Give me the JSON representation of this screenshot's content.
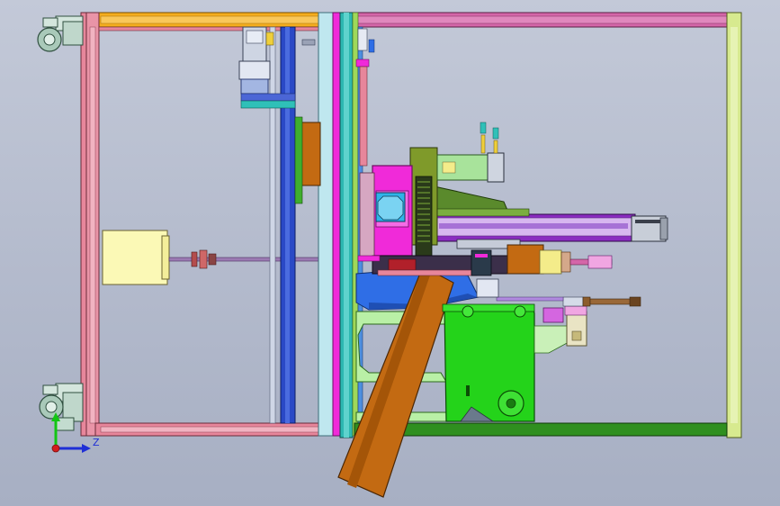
{
  "viewport": {
    "kind": "cad-assembly-side-view",
    "background_top": "#c3c9d8",
    "background_bottom": "#a7afc3"
  },
  "triad": {
    "z_label": "Z",
    "colors": {
      "y_axis": "#12c512",
      "z_axis": "#1f2fd6",
      "origin": "#d31d1d"
    }
  },
  "palette": {
    "frame_pink": "#e7869b",
    "frame_orange": "#f4ad1e",
    "frame_magenta": "#d466a8",
    "frame_yellowgreen": "#d7ea8f",
    "rail_blue": "#2a49c6",
    "plate_green": "#24d31a",
    "arm_brown": "#c36a12",
    "block_magenta": "#f02ad9",
    "motor_lightyellow": "#fbf9b6",
    "table_blue": "#2f6ee6",
    "base_darkgreen": "#2f8f1f"
  }
}
